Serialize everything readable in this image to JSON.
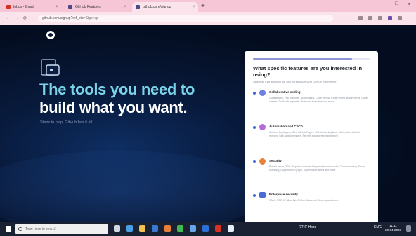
{
  "browser": {
    "tabs": [
      {
        "label": "Inbox - Gmail",
        "color": "#d93025"
      },
      {
        "label": "GitHub Features",
        "color": "#4a4a8a"
      },
      {
        "label": "github.com/signup",
        "color": "#4a4a8a"
      }
    ],
    "new_tab": "+",
    "window_controls": [
      "–",
      "□",
      "✕"
    ],
    "url": "github.com/signup?ref_cta=Sign+up",
    "nav": [
      "←",
      "→",
      "⟳"
    ]
  },
  "page": {
    "hero_line1": "The tools you need to",
    "hero_line2": "build what you want.",
    "subtext": "Steps to help, GitHub has it all."
  },
  "survey": {
    "progress": 0.85,
    "question": "What specific features are you interested in using?",
    "hint": "Select all that apply so we can personalize your GitHub experience.",
    "options": [
      {
        "title": "Collaborative coding",
        "desc": "Codespaces, Pull requests, Notifications, Code review, Code review assignments, Code owners, Draft pull requests, Protected branches and more.",
        "icon_color": "#6f7fe8"
      },
      {
        "title": "Automation and CI/CD",
        "desc": "Actions, Packages, APIs, GitHub Pages, GitHub Marketplace, Webhooks, Hosted runners, Self-hosted runners, Secrets management and more.",
        "icon_color": "#b56ad8"
      },
      {
        "title": "Security",
        "desc": "Private repos, 2FA, Required reviews, Required status checks, Code scanning, Secret scanning, Dependency graph, Dependabot alerts and more.",
        "icon_color": "#e8823a"
      },
      {
        "title": "Enterprise security",
        "desc": "SAML SSO, IP allow list, GitHub Advanced Security and more.",
        "icon_color": "#4a6bd6"
      }
    ]
  },
  "taskbar": {
    "search_placeholder": "Type here to search",
    "tray_weather": "27°C  Haze",
    "tray_lang": "ENG",
    "time": "11:11",
    "date": "20-04-2023"
  }
}
